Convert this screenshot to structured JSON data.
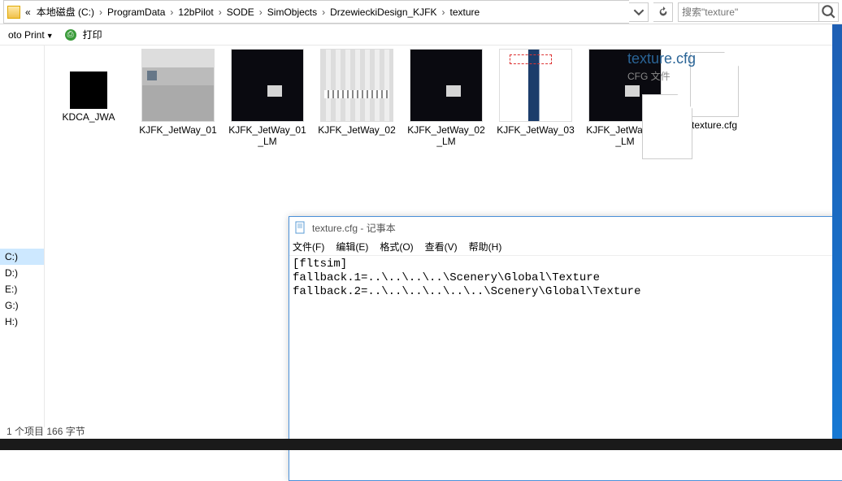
{
  "breadcrumb": {
    "start": "«",
    "items": [
      "本地磁盘 (C:)",
      "ProgramData",
      "12bPilot",
      "SODE",
      "SimObjects",
      "DrzewieckiDesign_KJFK",
      "texture"
    ]
  },
  "search": {
    "placeholder": "搜索\"texture\""
  },
  "toolbar": {
    "photo_print": "oto Print",
    "print_label": "打印"
  },
  "drives": [
    "C:)",
    "D:)",
    "E:)",
    "G:)",
    "H:)"
  ],
  "files": [
    {
      "name": "KDCA_JWA",
      "thumb": "kdca"
    },
    {
      "name": "KJFK_JetWay_01",
      "thumb": "jet1"
    },
    {
      "name": "KJFK_JetWay_01_LM",
      "thumb": "dark"
    },
    {
      "name": "KJFK_JetWay_02",
      "thumb": "jet2"
    },
    {
      "name": "KJFK_JetWay_02_LM",
      "thumb": "dark"
    },
    {
      "name": "KJFK_JetWay_03",
      "thumb": "jet3"
    },
    {
      "name": "KJFK_JetWay_03_LM",
      "thumb": "dark"
    },
    {
      "name": "texture.cfg",
      "thumb": "doc"
    }
  ],
  "preview": {
    "title": "texture.cfg",
    "type": "CFG 文件"
  },
  "notepad": {
    "title": "texture.cfg - 记事本",
    "menu": [
      "文件(F)",
      "编辑(E)",
      "格式(O)",
      "查看(V)",
      "帮助(H)"
    ],
    "content": "[fltsim]\nfallback.1=..\\..\\..\\..\\Scenery\\Global\\Texture\nfallback.2=..\\..\\..\\..\\..\\..\\Scenery\\Global\\Texture"
  },
  "status": "1 个项目  166 字节"
}
